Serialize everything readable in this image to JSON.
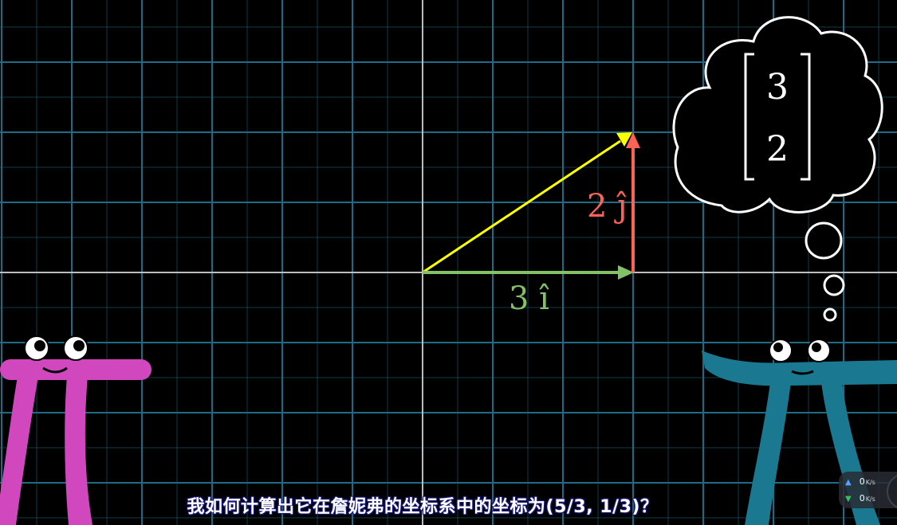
{
  "diagram": {
    "vector_labels": {
      "i_component": "3 î",
      "j_component": "2 ĵ"
    },
    "thought_bubble": {
      "matrix_top": "3",
      "matrix_bottom": "2"
    },
    "colors": {
      "background": "#000000",
      "grid_line": "#1f6a84",
      "axis": "#bdbdbd",
      "i_vector": "#83c167",
      "j_vector": "#fc6255",
      "sum_vector": "#ffff00",
      "left_pi": "#d147bd",
      "right_pi": "#1a7890"
    }
  },
  "subtitle": "我如何计算出它在詹妮弗的坐标系中的坐标为(5/3, 1/3)？",
  "network_widget": {
    "upload_value": "0",
    "upload_unit": "K/s",
    "download_value": "0",
    "download_unit": "K/s",
    "upload_icon": "arrow-up-icon",
    "download_icon": "arrow-down-icon"
  }
}
